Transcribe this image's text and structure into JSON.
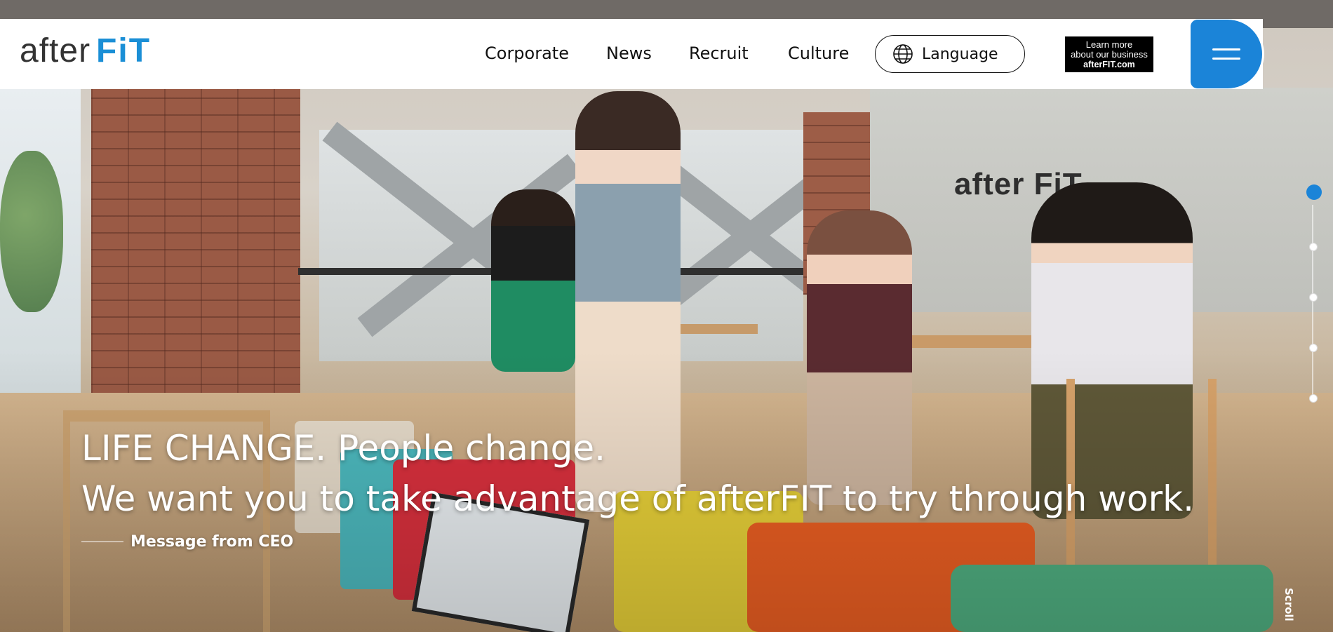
{
  "brand": {
    "logo_prefix": "after",
    "logo_suffix": "FiT",
    "logo_color": "#1b8fd6",
    "text_color": "#333333"
  },
  "nav": {
    "items": [
      {
        "label": "Corporate"
      },
      {
        "label": "News"
      },
      {
        "label": "Recruit"
      },
      {
        "label": "Culture"
      }
    ],
    "language_label": "Language",
    "language_icon": "globe-icon",
    "business_button": {
      "line1": "Learn more",
      "line2": "about our business",
      "line3": "afterFIT.com"
    },
    "menu_icon": "hamburger-icon",
    "menu_color": "#1b84d8"
  },
  "hero": {
    "headline_line1": "LIFE CHANGE. People change.",
    "headline_line2": "We want you to take advantage of afterFIT to try through work.",
    "cta_label": "Message from CEO",
    "wall_sign": "after FiT",
    "slide_count": 5,
    "active_slide": 1,
    "scroll_label": "Scroll"
  }
}
